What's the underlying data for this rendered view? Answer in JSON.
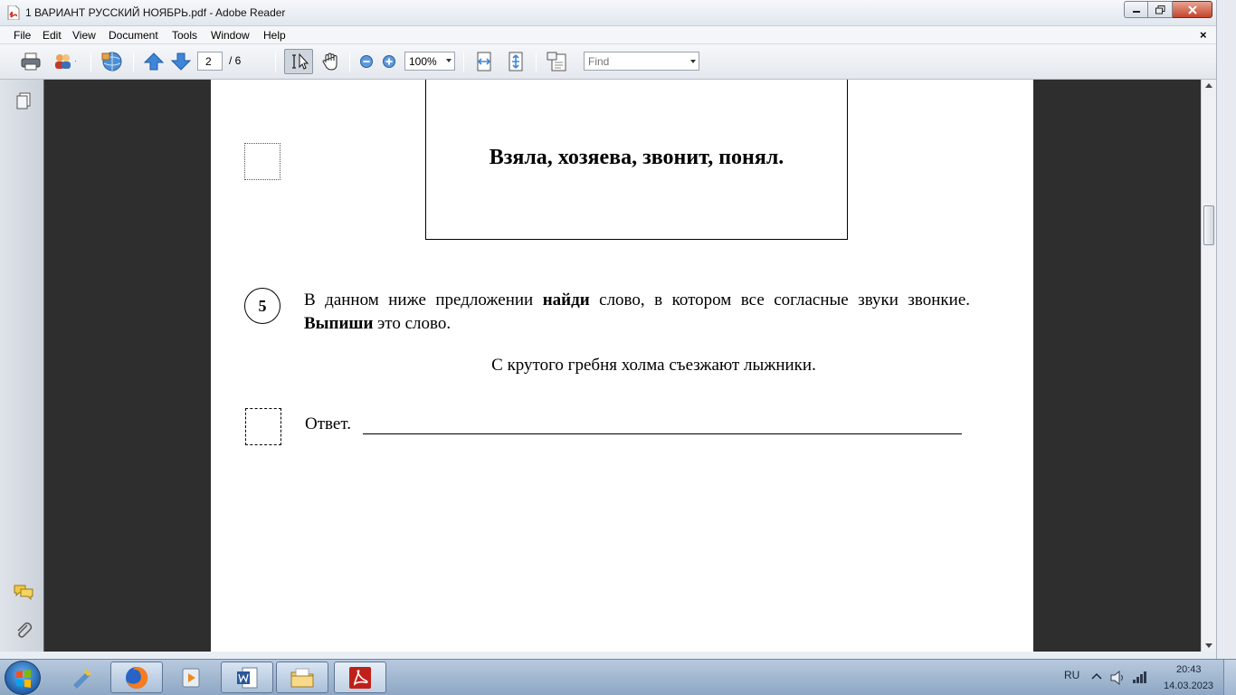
{
  "window": {
    "title": "1 ВАРИАНТ РУССКИЙ НОЯБРЬ.pdf - Adobe Reader"
  },
  "menu": {
    "items": [
      "File",
      "Edit",
      "View",
      "Document",
      "Tools",
      "Window",
      "Help"
    ],
    "close_glyph": "×"
  },
  "toolbar": {
    "page_current": "2",
    "page_total": "/ 6",
    "zoom": "100%",
    "find_placeholder": "Find"
  },
  "document": {
    "word_list": "Взяла, хозяева, звонит, понял.",
    "question_number": "5",
    "question_text_parts": [
      {
        "text": "В данном ниже предложении ",
        "bold": false
      },
      {
        "text": "найди",
        "bold": true
      },
      {
        "text": " слово, в котором все согласные звуки звонкие. ",
        "bold": false
      },
      {
        "text": "Выпиши",
        "bold": true
      },
      {
        "text": " это слово.",
        "bold": false
      }
    ],
    "sentence": "С крутого гребня холма съезжают лыжники.",
    "answer_label": "Ответ."
  },
  "taskbar": {
    "language": "RU",
    "time": "20:43",
    "date": "14.03.2023"
  },
  "icons": {
    "app": "pdf-document-icon",
    "colors": {
      "accent": "#c4452b",
      "doc_background": "#2e2e2e"
    }
  }
}
